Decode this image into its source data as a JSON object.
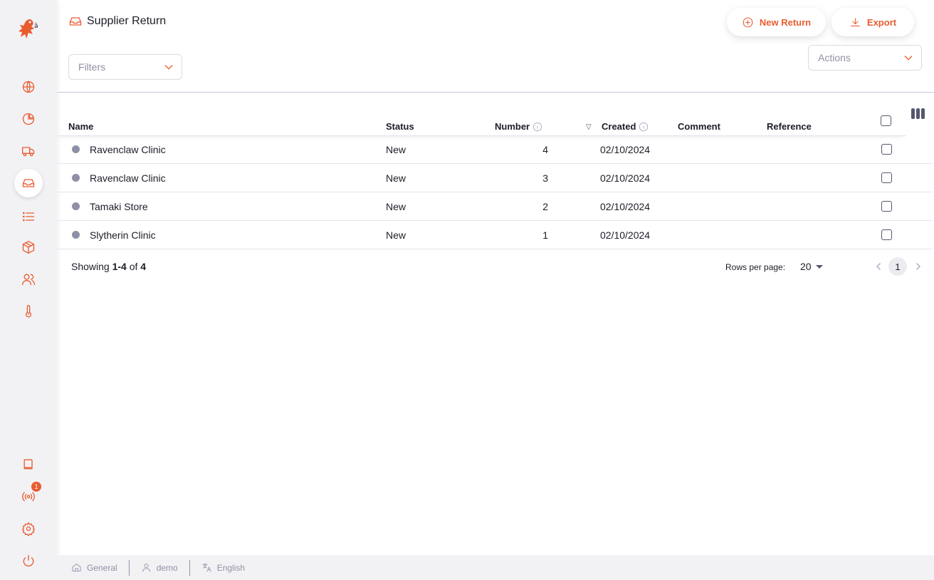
{
  "header": {
    "title": "Supplier Return",
    "title_icon": "inbox-icon",
    "new_return_label": "New Return",
    "export_label": "Export",
    "filters_placeholder": "Filters",
    "actions_placeholder": "Actions"
  },
  "sidebar": {
    "items": [
      {
        "icon": "globe-icon"
      },
      {
        "icon": "pie-chart-icon"
      },
      {
        "icon": "truck-icon"
      },
      {
        "icon": "inbox-icon",
        "active": true
      },
      {
        "icon": "list-icon"
      },
      {
        "icon": "package-icon"
      },
      {
        "icon": "users-icon"
      },
      {
        "icon": "thermometer-icon"
      }
    ],
    "bottom_items": [
      {
        "icon": "book-icon"
      },
      {
        "icon": "broadcast-icon",
        "badge": "1"
      },
      {
        "icon": "gear-icon"
      },
      {
        "icon": "power-icon"
      }
    ]
  },
  "table": {
    "columns": {
      "name": "Name",
      "status": "Status",
      "number": "Number",
      "created": "Created",
      "comment": "Comment",
      "reference": "Reference"
    },
    "rows": [
      {
        "name": "Ravenclaw Clinic",
        "status": "New",
        "number": "4",
        "created": "02/10/2024",
        "comment": "",
        "reference": ""
      },
      {
        "name": "Ravenclaw Clinic",
        "status": "New",
        "number": "3",
        "created": "02/10/2024",
        "comment": "",
        "reference": ""
      },
      {
        "name": "Tamaki Store",
        "status": "New",
        "number": "2",
        "created": "02/10/2024",
        "comment": "",
        "reference": ""
      },
      {
        "name": "Slytherin Clinic",
        "status": "New",
        "number": "1",
        "created": "02/10/2024",
        "comment": "",
        "reference": ""
      }
    ]
  },
  "pagination": {
    "showing_label": "Showing",
    "range": "1-4",
    "of_label": "of",
    "total": "4",
    "rows_per_page_label": "Rows per page:",
    "rows_per_page": "20",
    "current_page": "1"
  },
  "footer": {
    "store": "General",
    "user": "demo",
    "language": "English"
  },
  "colors": {
    "accent": "#e95c30",
    "status_dot": "#8f90a6"
  }
}
